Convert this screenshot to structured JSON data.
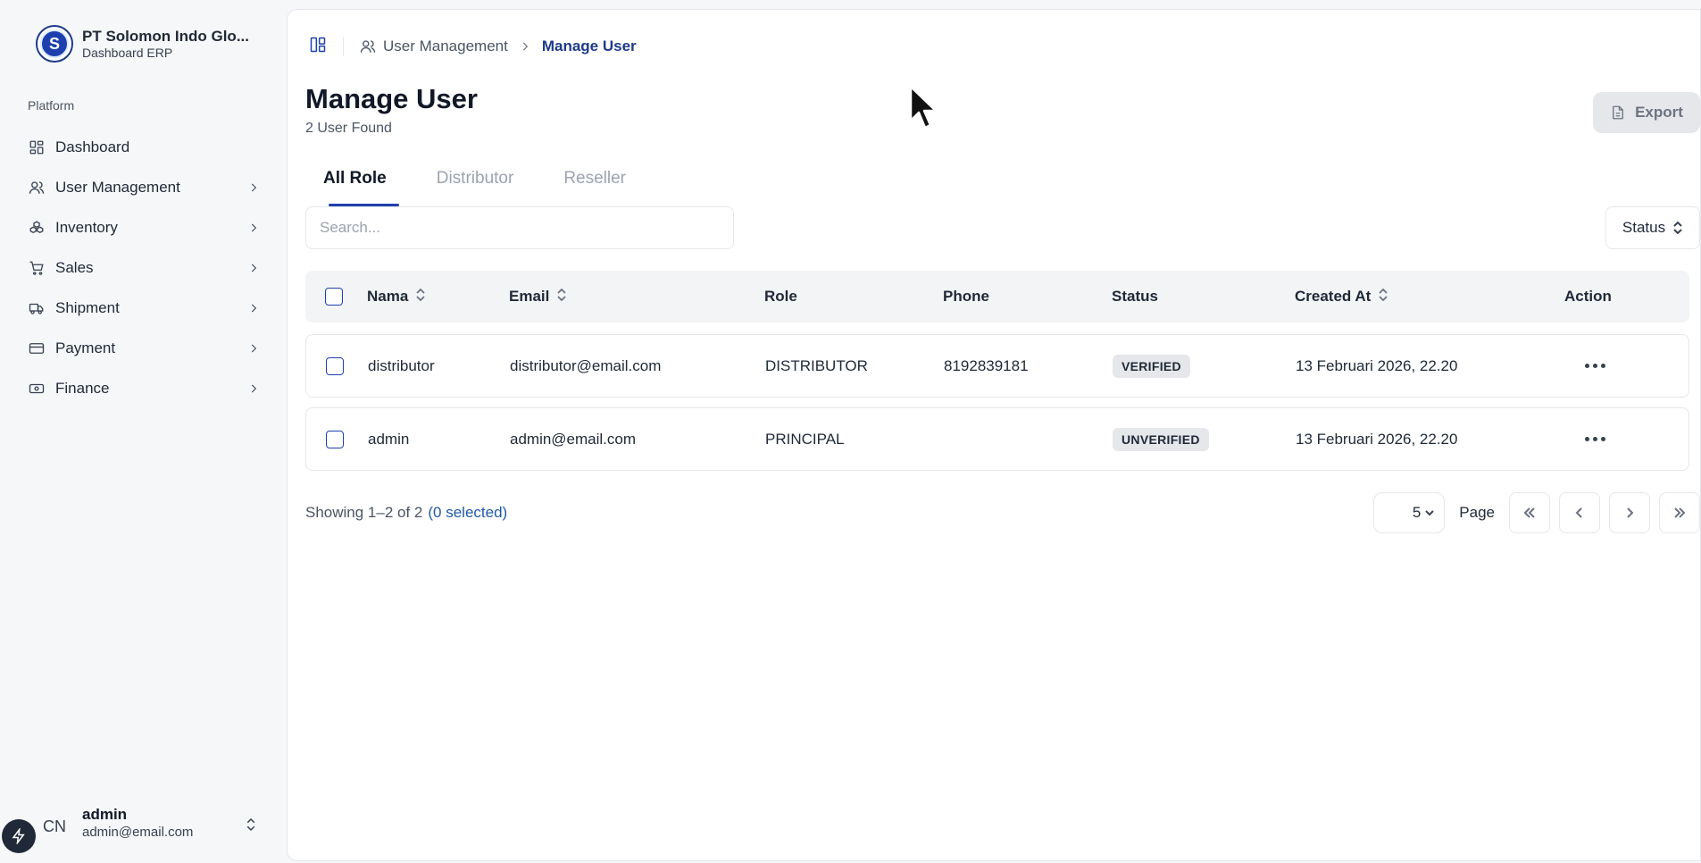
{
  "brand": {
    "name": "PT Solomon Indo Glo...",
    "subtitle": "Dashboard ERP",
    "logo_letter": "S"
  },
  "sidebar": {
    "section_label": "Platform",
    "items": [
      {
        "label": "Dashboard",
        "icon": "dashboard-icon",
        "has_chevron": false
      },
      {
        "label": "User Management",
        "icon": "users-icon",
        "has_chevron": true
      },
      {
        "label": "Inventory",
        "icon": "boxes-icon",
        "has_chevron": true
      },
      {
        "label": "Sales",
        "icon": "cart-icon",
        "has_chevron": true
      },
      {
        "label": "Shipment",
        "icon": "truck-icon",
        "has_chevron": true
      },
      {
        "label": "Payment",
        "icon": "card-icon",
        "has_chevron": true
      },
      {
        "label": "Finance",
        "icon": "banknote-icon",
        "has_chevron": true
      }
    ]
  },
  "user": {
    "initials": "CN",
    "name": "admin",
    "email": "admin@email.com"
  },
  "breadcrumb": {
    "parent": "User Management",
    "current": "Manage User"
  },
  "page": {
    "title": "Manage User",
    "subtitle": "2 User Found",
    "export_label": "Export"
  },
  "tabs": [
    {
      "label": "All Role",
      "active": true
    },
    {
      "label": "Distributor",
      "active": false
    },
    {
      "label": "Reseller",
      "active": false
    }
  ],
  "search": {
    "placeholder": "Search...",
    "value": ""
  },
  "status_filter": {
    "label": "Status"
  },
  "table": {
    "columns": {
      "nama": "Nama",
      "email": "Email",
      "role": "Role",
      "phone": "Phone",
      "status": "Status",
      "created_at": "Created At",
      "action": "Action"
    },
    "rows": [
      {
        "nama": "distributor",
        "email": "distributor@email.com",
        "role": "DISTRIBUTOR",
        "phone": "8192839181",
        "status": "VERIFIED",
        "created_at": "13 Februari 2026, 22.20"
      },
      {
        "nama": "admin",
        "email": "admin@email.com",
        "role": "PRINCIPAL",
        "phone": "",
        "status": "UNVERIFIED",
        "created_at": "13 Februari 2026, 22.20"
      }
    ]
  },
  "footer": {
    "showing": "Showing 1–2 of 2",
    "selected": "(0 selected)",
    "page_size": "5",
    "page_label": "Page"
  },
  "colors": {
    "accent": "#1e40af",
    "breadcrumb_current": "#1e3a8a",
    "badge_bg": "#e5e7eb"
  }
}
